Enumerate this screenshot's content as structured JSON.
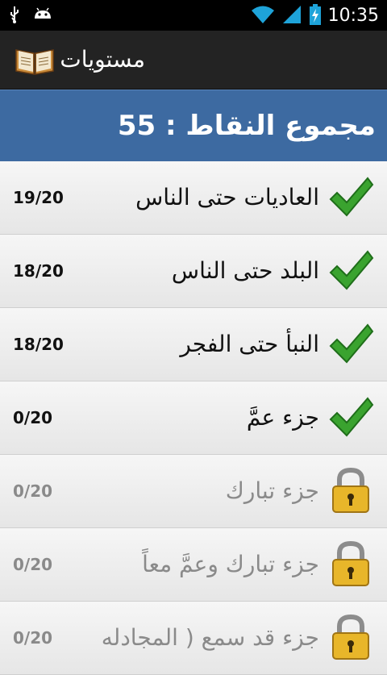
{
  "status_bar": {
    "time": "10:35",
    "icons": [
      "usb-icon",
      "android-icon",
      "wifi-icon",
      "signal-icon",
      "battery-charging-icon"
    ]
  },
  "action_bar": {
    "title": "مستويات",
    "icon": "book-icon"
  },
  "header": {
    "total_label": "مجموع النقاط : 55"
  },
  "levels": [
    {
      "title": "العاديات حتى الناس",
      "score": "19/20",
      "status": "completed",
      "icon": "checkmark-icon"
    },
    {
      "title": "البلد حتى الناس",
      "score": "18/20",
      "status": "completed",
      "icon": "checkmark-icon"
    },
    {
      "title": "النبأ حتى الفجر",
      "score": "18/20",
      "status": "completed",
      "icon": "checkmark-icon"
    },
    {
      "title": "جزء عمَّ",
      "score": "0/20",
      "status": "completed",
      "icon": "checkmark-icon"
    },
    {
      "title": "جزء تبارك",
      "score": "0/20",
      "status": "locked",
      "icon": "lock-icon"
    },
    {
      "title": "جزء تبارك وعمَّ معاً",
      "score": "0/20",
      "status": "locked",
      "icon": "lock-icon"
    },
    {
      "title": "جزء قد سمع ( المجادله",
      "score": "0/20",
      "status": "locked",
      "icon": "lock-icon"
    }
  ],
  "colors": {
    "header_blue": "#3d6aa1",
    "action_bar": "#232323",
    "check_green": "#3aa32f",
    "lock_gold": "#e8b62a"
  }
}
